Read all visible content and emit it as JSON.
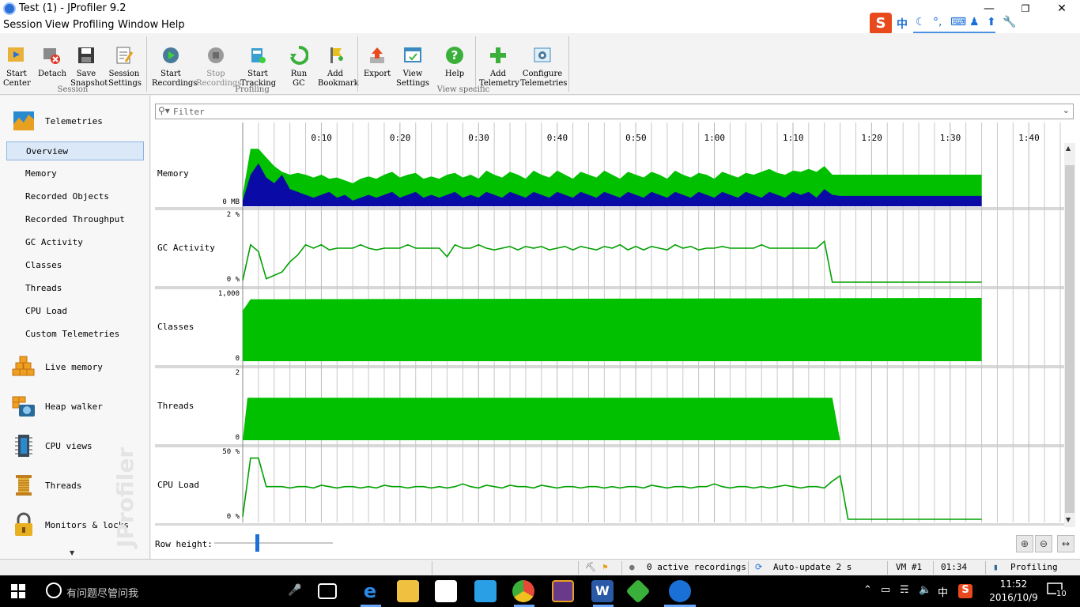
{
  "window": {
    "title": "Test (1) - JProfiler 9.2",
    "minimize": "—",
    "maximize": "❐",
    "close": "✕"
  },
  "menu": [
    "Session",
    "View",
    "Profiling",
    "Window",
    "Help"
  ],
  "toolbar": {
    "groups": [
      {
        "label": "Session",
        "buttons": [
          {
            "label": "Start\nCenter",
            "icon": "start-center-icon"
          },
          {
            "label": "Detach",
            "icon": "detach-icon"
          },
          {
            "label": "Save\nSnapshot",
            "icon": "save-icon"
          },
          {
            "label": "Session\nSettings",
            "icon": "settings-icon"
          }
        ]
      },
      {
        "label": "Profiling",
        "buttons": [
          {
            "label": "Start\nRecordings",
            "icon": "record-icon"
          },
          {
            "label": "Stop\nRecordings",
            "icon": "stop-icon",
            "disabled": true
          },
          {
            "label": "Start\nTracking",
            "icon": "tracking-icon"
          },
          {
            "label": "Run GC",
            "icon": "gc-icon"
          },
          {
            "label": "Add\nBookmark",
            "icon": "bookmark-icon"
          }
        ]
      },
      {
        "label": "View specific",
        "buttons": [
          {
            "label": "Export",
            "icon": "export-icon"
          },
          {
            "label": "View\nSettings",
            "icon": "view-settings-icon"
          },
          {
            "label": "Help",
            "icon": "help-icon"
          },
          {
            "label": "Add\nTelemetry",
            "icon": "add-icon"
          },
          {
            "label": "Configure\nTelemetries",
            "icon": "configure-icon"
          }
        ]
      }
    ]
  },
  "sidebar": {
    "sections": [
      {
        "label": "Telemetries",
        "icon": "telemetries-icon"
      },
      {
        "label": "Live memory",
        "icon": "live-memory-icon"
      },
      {
        "label": "Heap walker",
        "icon": "heap-walker-icon"
      },
      {
        "label": "CPU views",
        "icon": "cpu-views-icon"
      },
      {
        "label": "Threads",
        "icon": "threads-icon"
      },
      {
        "label": "Monitors & locks",
        "icon": "lock-icon"
      }
    ],
    "telemetry_items": [
      "Overview",
      "Memory",
      "Recorded Objects",
      "Recorded Throughput",
      "GC Activity",
      "Classes",
      "Threads",
      "CPU Load",
      "Custom Telemetries"
    ],
    "selected": "Overview",
    "watermark": "JProfiler"
  },
  "filter": {
    "placeholder": "Filter"
  },
  "timeline": {
    "ticks": [
      "0:10",
      "0:20",
      "0:30",
      "0:40",
      "0:50",
      "1:00",
      "1:10",
      "1:20",
      "1:30",
      "1:40"
    ],
    "tick_seconds": [
      10,
      20,
      30,
      40,
      50,
      60,
      70,
      80,
      90,
      100
    ],
    "max_seconds": 104,
    "end_seconds": 94
  },
  "chart_data": [
    {
      "type": "area",
      "title": "Memory",
      "ylabel_bottom": "0 MB",
      "colors": {
        "used": "#0a0aa6",
        "free": "#00c000"
      },
      "x": [
        0,
        1,
        2,
        3,
        4,
        5,
        6,
        7,
        8,
        9,
        10,
        11,
        12,
        13,
        14,
        15,
        16,
        17,
        18,
        19,
        20,
        21,
        22,
        23,
        24,
        25,
        26,
        27,
        28,
        29,
        30,
        31,
        32,
        33,
        34,
        35,
        36,
        37,
        38,
        39,
        40,
        41,
        42,
        43,
        44,
        45,
        46,
        47,
        48,
        49,
        50,
        51,
        52,
        53,
        54,
        55,
        56,
        57,
        58,
        59,
        60,
        61,
        62,
        63,
        64,
        65,
        66,
        67,
        68,
        69,
        70,
        71,
        72,
        73,
        74,
        75,
        76,
        94
      ],
      "series": [
        {
          "name": "Used",
          "values": [
            10,
            55,
            75,
            50,
            40,
            55,
            30,
            25,
            20,
            15,
            20,
            25,
            15,
            20,
            10,
            15,
            20,
            15,
            20,
            25,
            15,
            20,
            25,
            15,
            20,
            15,
            20,
            25,
            15,
            20,
            15,
            25,
            20,
            15,
            25,
            20,
            15,
            25,
            20,
            15,
            25,
            20,
            15,
            25,
            20,
            15,
            25,
            20,
            15,
            25,
            20,
            15,
            25,
            20,
            15,
            25,
            20,
            15,
            25,
            20,
            15,
            25,
            20,
            15,
            25,
            20,
            15,
            25,
            20,
            15,
            25,
            20,
            25,
            15,
            30,
            20,
            18,
            18
          ]
        },
        {
          "name": "Total",
          "values": [
            20,
            100,
            100,
            85,
            70,
            60,
            55,
            58,
            55,
            50,
            55,
            48,
            50,
            45,
            40,
            48,
            52,
            48,
            55,
            60,
            50,
            55,
            58,
            48,
            52,
            48,
            55,
            58,
            50,
            55,
            48,
            62,
            55,
            50,
            60,
            55,
            48,
            62,
            55,
            50,
            62,
            55,
            48,
            60,
            55,
            50,
            62,
            55,
            48,
            60,
            55,
            50,
            60,
            55,
            48,
            62,
            55,
            50,
            58,
            55,
            48,
            60,
            55,
            50,
            58,
            55,
            60,
            65,
            58,
            55,
            62,
            60,
            65,
            60,
            70,
            55,
            55,
            55
          ]
        }
      ]
    },
    {
      "type": "line",
      "title": "GC Activity",
      "y_top_label": "2 %",
      "y_bottom_label": "0 %",
      "ylim": [
        0,
        2
      ],
      "color": "#00a000",
      "x": [
        0,
        1,
        2,
        3,
        4,
        5,
        6,
        7,
        8,
        9,
        10,
        11,
        12,
        13,
        14,
        15,
        16,
        17,
        18,
        19,
        20,
        21,
        22,
        23,
        24,
        25,
        26,
        27,
        28,
        29,
        30,
        31,
        32,
        33,
        34,
        35,
        36,
        37,
        38,
        39,
        40,
        41,
        42,
        43,
        44,
        45,
        46,
        47,
        48,
        49,
        50,
        51,
        52,
        53,
        54,
        55,
        56,
        57,
        58,
        59,
        60,
        61,
        62,
        63,
        64,
        65,
        66,
        67,
        68,
        69,
        70,
        71,
        72,
        73,
        74,
        75,
        76,
        94
      ],
      "values": [
        0.05,
        1.1,
        0.9,
        0.1,
        0.2,
        0.3,
        0.6,
        0.8,
        1.1,
        1.0,
        1.1,
        0.95,
        1.0,
        1.0,
        1.0,
        1.1,
        1.0,
        0.95,
        1.0,
        1.0,
        1.0,
        1.1,
        1.0,
        1.0,
        1.0,
        1.0,
        0.75,
        1.1,
        1.0,
        1.0,
        1.1,
        1.0,
        0.95,
        1.0,
        1.05,
        0.95,
        1.05,
        1.0,
        1.05,
        0.95,
        1.0,
        1.05,
        0.95,
        1.05,
        1.0,
        0.95,
        1.05,
        1.0,
        1.1,
        0.95,
        1.05,
        0.95,
        1.05,
        1.0,
        0.95,
        1.1,
        1.0,
        1.05,
        0.95,
        1.0,
        1.0,
        1.05,
        1.0,
        1.0,
        1.0,
        1.0,
        1.1,
        1.0,
        1.0,
        1.0,
        1.0,
        1.0,
        1.0,
        1.0,
        1.2,
        0.0,
        0.0,
        0.0
      ]
    },
    {
      "type": "area",
      "title": "Classes",
      "y_top_label": "1,000",
      "y_bottom_label": "0",
      "ylim": [
        0,
        1000
      ],
      "color": "#00c000",
      "x": [
        0,
        1,
        4,
        94
      ],
      "values": [
        800,
        980,
        980,
        1000
      ]
    },
    {
      "type": "area",
      "title": "Threads",
      "y_top_label": "2",
      "y_bottom_label": "0",
      "ylim": [
        0,
        2
      ],
      "color": "#00c000",
      "x": [
        0,
        0.6,
        75,
        76
      ],
      "values": [
        0,
        1,
        1,
        0
      ]
    },
    {
      "type": "line",
      "title": "CPU Load",
      "y_top_label": "50 %",
      "y_bottom_label": "0 %",
      "ylim": [
        0,
        50
      ],
      "color": "#00a000",
      "x": [
        0,
        1,
        2,
        3,
        4,
        5,
        6,
        7,
        8,
        9,
        10,
        11,
        12,
        13,
        14,
        15,
        16,
        17,
        18,
        19,
        20,
        21,
        22,
        23,
        24,
        25,
        26,
        27,
        28,
        29,
        30,
        31,
        32,
        33,
        34,
        35,
        36,
        37,
        38,
        39,
        40,
        41,
        42,
        43,
        44,
        45,
        46,
        47,
        48,
        49,
        50,
        51,
        52,
        53,
        54,
        55,
        56,
        57,
        58,
        59,
        60,
        61,
        62,
        63,
        64,
        65,
        66,
        67,
        68,
        69,
        70,
        71,
        72,
        73,
        74,
        75,
        76,
        77,
        94
      ],
      "values": [
        2,
        45,
        45,
        24,
        24,
        24,
        23,
        24,
        24,
        23,
        25,
        24,
        23,
        24,
        24,
        23,
        24,
        23,
        25,
        24,
        24,
        23,
        24,
        24,
        23,
        24,
        23,
        24,
        26,
        24,
        23,
        25,
        24,
        23,
        25,
        24,
        24,
        23,
        25,
        24,
        23,
        24,
        24,
        23,
        24,
        24,
        23,
        24,
        23,
        24,
        24,
        23,
        25,
        24,
        23,
        24,
        24,
        23,
        24,
        24,
        26,
        24,
        23,
        24,
        24,
        23,
        24,
        23,
        24,
        25,
        24,
        23,
        24,
        24,
        23,
        28,
        32,
        0,
        0
      ]
    }
  ],
  "row_height_label": "Row height:",
  "statusbar": {
    "recordings": "0 active recordings",
    "autoupdate": "Auto-update 2 s",
    "vm": "VM #1",
    "time": "01:34",
    "mode": "Profiling"
  },
  "taskbar": {
    "search": "有问题尽管问我",
    "time": "11:52",
    "date": "2016/10/9",
    "notifications": "10",
    "ime_lang": "中"
  },
  "ime": {
    "lang": "中"
  }
}
